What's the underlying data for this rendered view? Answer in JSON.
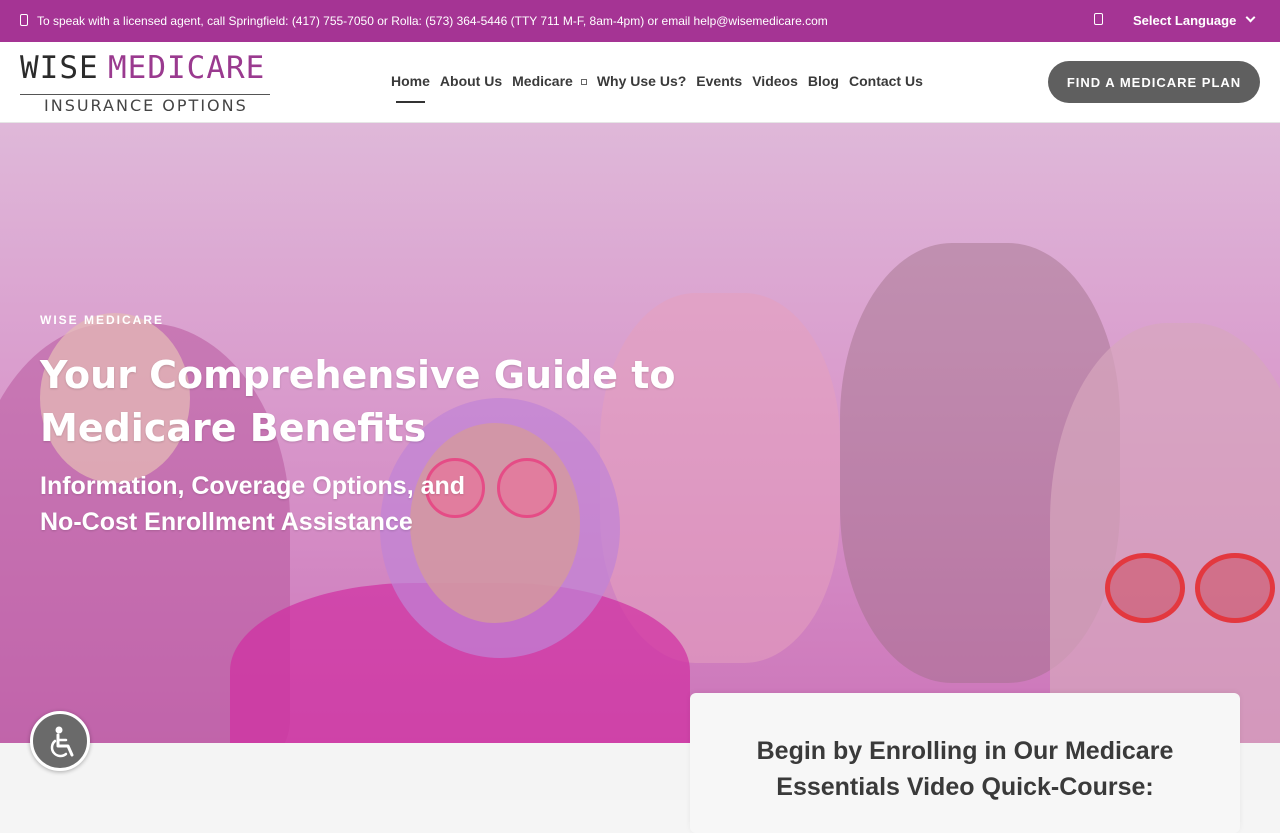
{
  "topbar": {
    "contact_text": "To speak with a licensed agent, call Springfield: (417) 755-7050 or Rolla: (573) 364-5446 (TTY 711 M-F, 8am-4pm) or email help@wisemedicare.com",
    "language_label": "Select Language",
    "phone_icon": "phone-icon",
    "language_icon": "globe-icon"
  },
  "logo": {
    "word1": "WISE",
    "word2": "MEDICARE",
    "subtitle": "INSURANCE OPTIONS"
  },
  "nav": {
    "items": [
      {
        "label": "Home",
        "active": true
      },
      {
        "label": "About Us"
      },
      {
        "label": "Medicare",
        "has_dropdown": true
      },
      {
        "label": "Why Use Us?"
      },
      {
        "label": "Events"
      },
      {
        "label": "Videos"
      },
      {
        "label": "Blog"
      },
      {
        "label": "Contact Us"
      }
    ],
    "cta_label": "FIND A MEDICARE PLAN"
  },
  "hero": {
    "kicker": "WISE MEDICARE",
    "title": "Your Comprehensive Guide to Medicare Benefits",
    "subtitle": "Information, Coverage Options, and No-Cost Enrollment Assistance"
  },
  "card": {
    "title": "Begin by Enrolling in Our Medicare Essentials Video Quick-Course:"
  },
  "accessibility": {
    "icon": "wheelchair-icon"
  },
  "colors": {
    "brand_purple": "#a53494",
    "cta_gray": "#5f5f5f",
    "hero_tint": "#d99acc"
  }
}
